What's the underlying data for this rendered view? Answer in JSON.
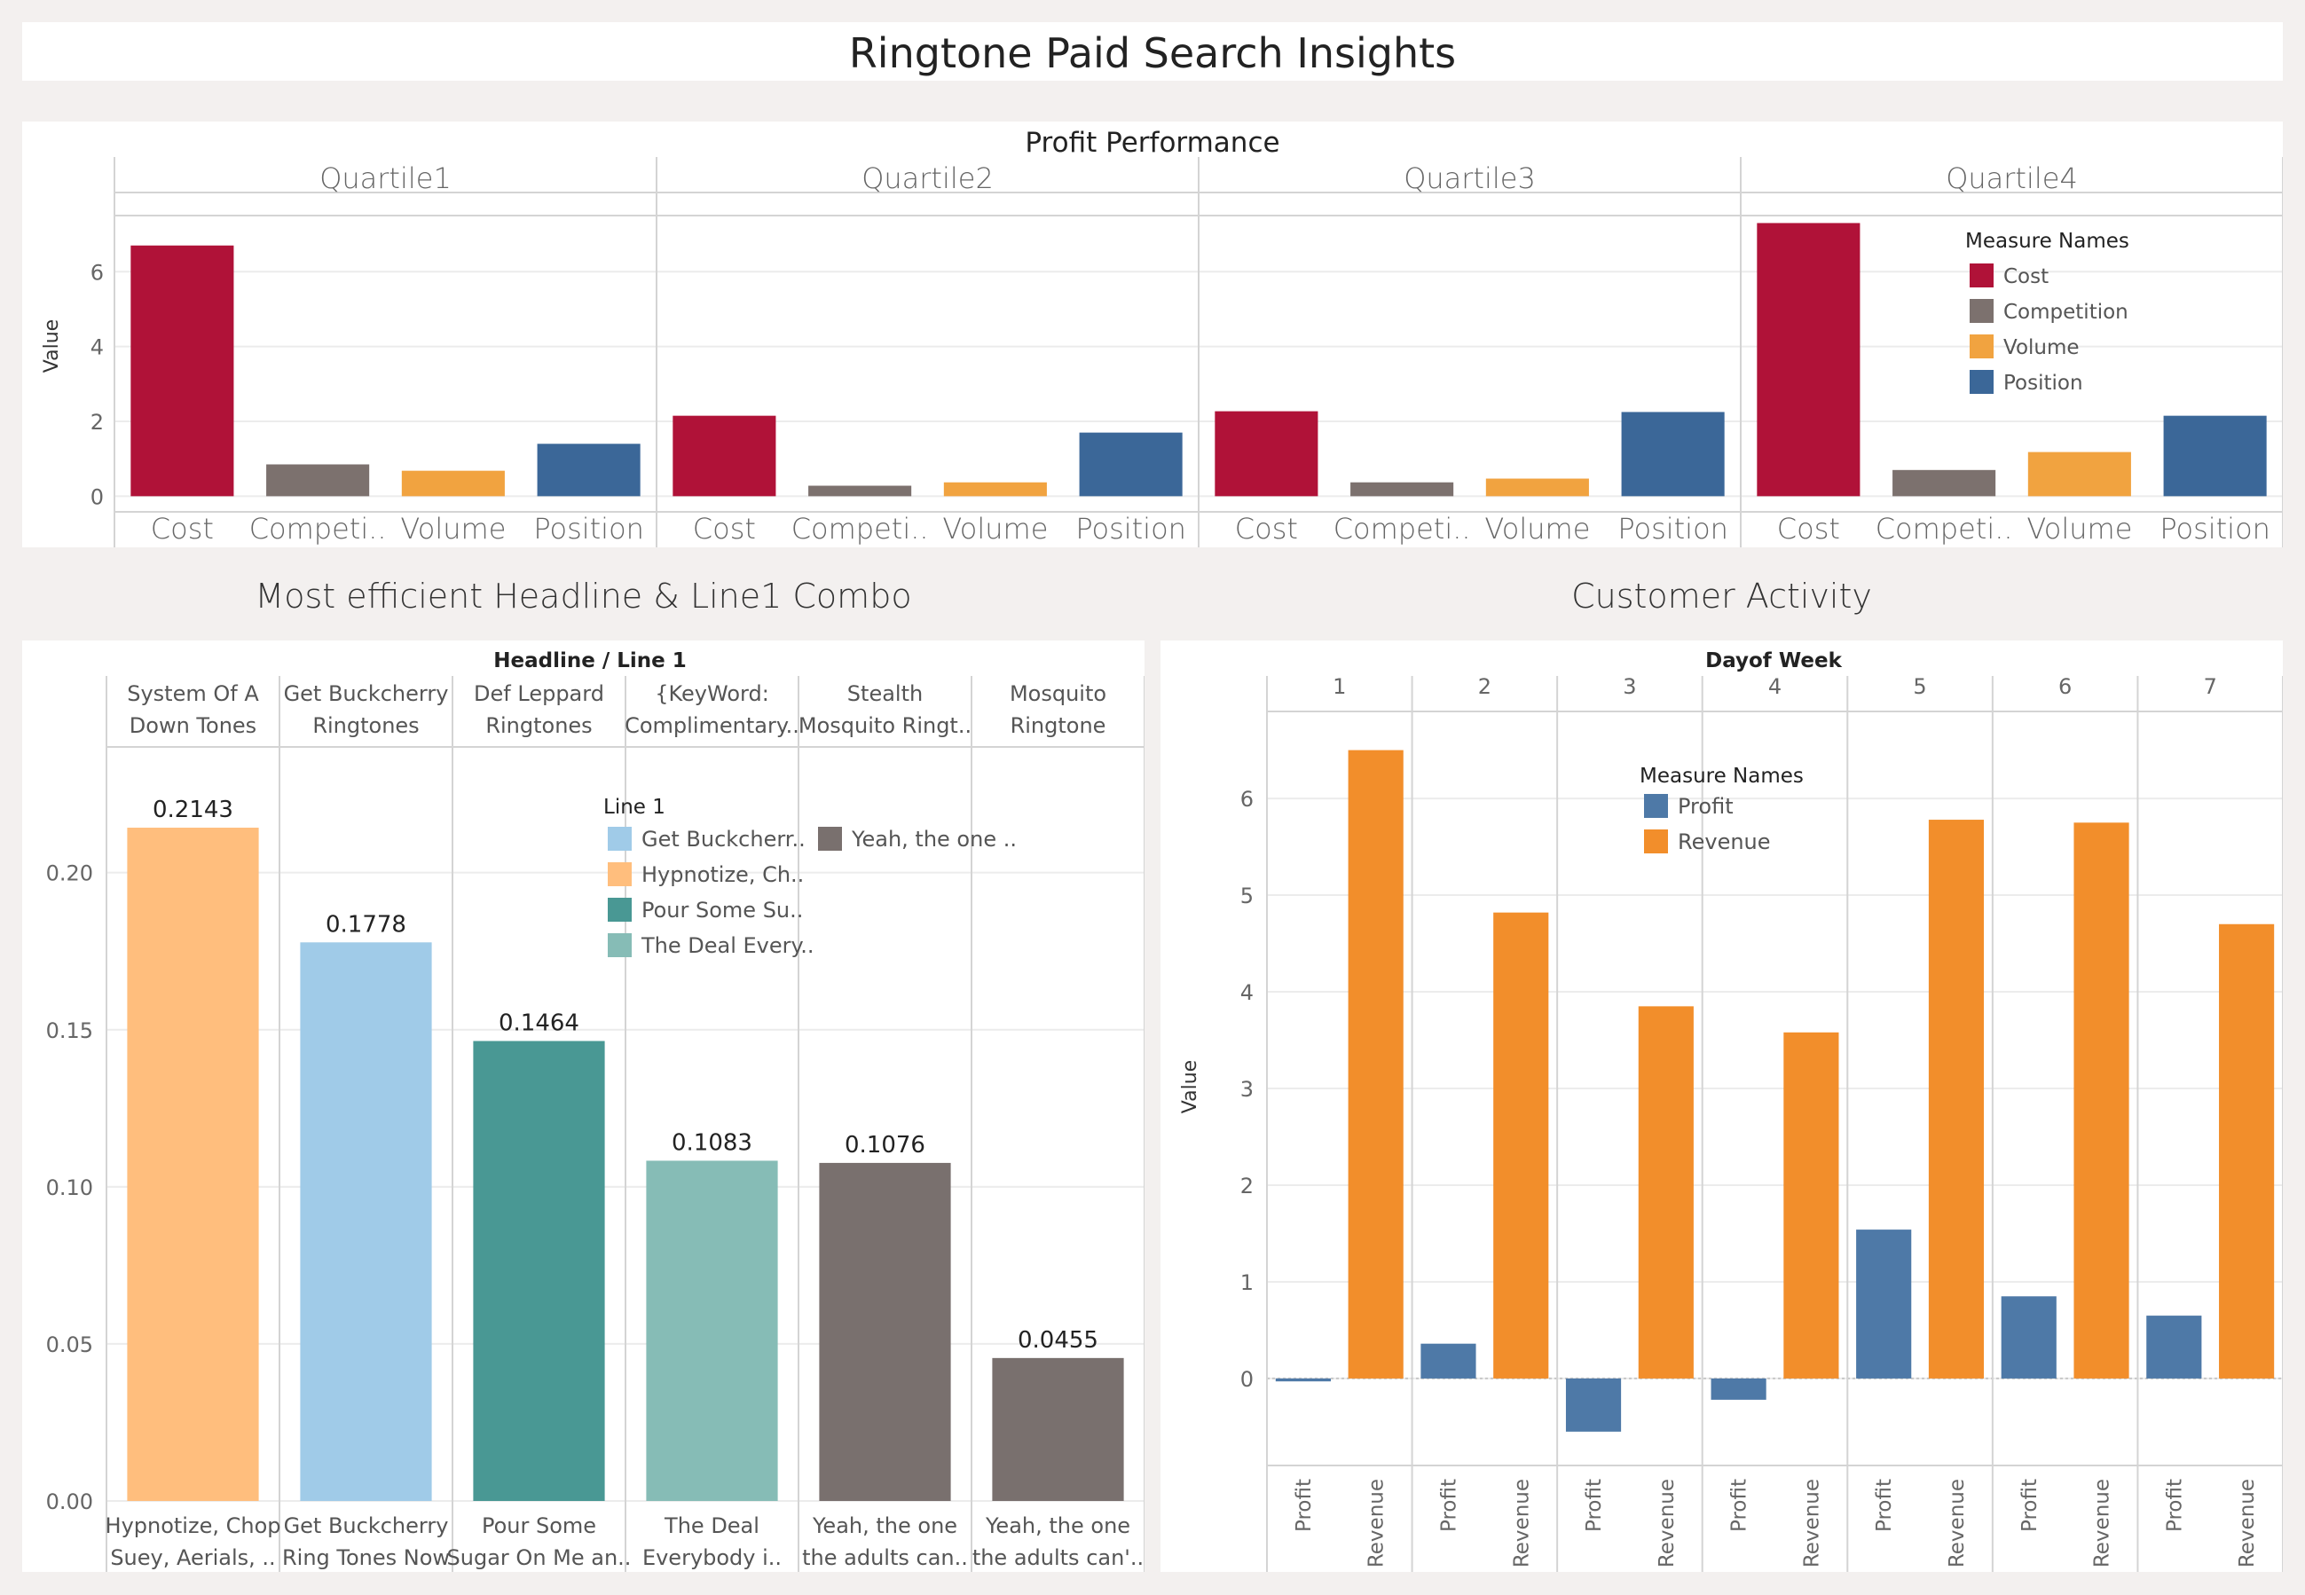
{
  "dashboard_title": "Ringtone Paid Search Insights",
  "colors": {
    "cost": "#b01238",
    "competition": "#7c716e",
    "volume": "#f1a340",
    "position": "#3b6798",
    "profit": "#4e79a7",
    "revenue": "#f28e2b",
    "hypnotize": "#ffbe7d",
    "get_buckcherry": "#a0cbe8",
    "pour_some": "#499894",
    "the_deal": "#86bcb6",
    "yeah_the_one": "#79706e"
  },
  "profit_panel": {
    "title": "Profit Performance",
    "legend_title": "Measure Names"
  },
  "headline_section_title": "Most efficient Headline & Line1 Combo",
  "headline_panel": {
    "header": "Headline  /  Line 1",
    "legend_title": "Line 1"
  },
  "customer_section_title": "Customer Activity",
  "customer_panel": {
    "header": "Dayof Week",
    "legend_title": "Measure Names"
  },
  "chart_data": [
    {
      "id": "profit_performance",
      "type": "bar",
      "title": "Profit Performance",
      "ylabel": "Value",
      "ylim": [
        -0.3,
        7.5
      ],
      "yticks": [
        0,
        2,
        4,
        6
      ],
      "facets": [
        "Quartile1",
        "Quartile2",
        "Quartile3",
        "Quartile4"
      ],
      "categories": [
        "Cost",
        "Competition",
        "Volume",
        "Position"
      ],
      "category_labels": [
        "Cost",
        "Competi..",
        "Volume",
        "Position"
      ],
      "series": [
        {
          "name": "Cost",
          "values": [
            6.7,
            2.15,
            2.27,
            7.3
          ]
        },
        {
          "name": "Competition",
          "values": [
            0.85,
            0.28,
            0.37,
            0.7
          ]
        },
        {
          "name": "Volume",
          "values": [
            0.68,
            0.37,
            0.47,
            1.18
          ]
        },
        {
          "name": "Position",
          "values": [
            1.4,
            1.7,
            2.25,
            2.15
          ]
        }
      ],
      "legend": {
        "title": "Measure Names",
        "items": [
          "Cost",
          "Competition",
          "Volume",
          "Position"
        ],
        "position": "top-right"
      },
      "grid": true
    },
    {
      "id": "headline_line1",
      "type": "bar",
      "title": "Most efficient Headline & Line1 Combo",
      "header": "Headline  /  Line 1",
      "ylim": [
        0,
        0.24
      ],
      "yticks": [
        0.0,
        0.05,
        0.1,
        0.15,
        0.2
      ],
      "ytick_labels": [
        "0.00",
        "0.05",
        "0.10",
        "0.15",
        "0.20"
      ],
      "headlines": [
        [
          "System Of A",
          "Down Tones"
        ],
        [
          "Get Buckcherry",
          "Ringtones"
        ],
        [
          "Def Leppard",
          "Ringtones"
        ],
        [
          "{KeyWord:",
          "Complimentary.."
        ],
        [
          "Stealth",
          "Mosquito Ringt.."
        ],
        [
          "Mosquito",
          "Ringtone"
        ]
      ],
      "line1": [
        [
          "Hypnotize, Chop",
          "Suey, Aerials, .."
        ],
        [
          "Get Buckcherry",
          "Ring Tones Now"
        ],
        [
          "Pour Some",
          "Sugar On Me an.."
        ],
        [
          "The Deal",
          "Everybody i.."
        ],
        [
          "Yeah, the one",
          "the adults can.."
        ],
        [
          "Yeah, the one",
          "the adults can'.."
        ]
      ],
      "values": [
        0.2143,
        0.1778,
        0.1464,
        0.1083,
        0.1076,
        0.0455
      ],
      "value_labels": [
        "0.2143",
        "0.1778",
        "0.1464",
        "0.1083",
        "0.1076",
        "0.0455"
      ],
      "bar_color_keys": [
        "hypnotize",
        "get_buckcherry",
        "pour_some",
        "the_deal",
        "yeah_the_one",
        "yeah_the_one"
      ],
      "legend": {
        "title": "Line 1",
        "items": [
          {
            "label": "Get Buckcherr..",
            "color_key": "get_buckcherry"
          },
          {
            "label": "Hypnotize, Ch..",
            "color_key": "hypnotize"
          },
          {
            "label": "Pour Some Su..",
            "color_key": "pour_some"
          },
          {
            "label": "The Deal Every..",
            "color_key": "the_deal"
          },
          {
            "label": "Yeah, the one ..",
            "color_key": "yeah_the_one"
          }
        ],
        "position": "top-right"
      },
      "grid": true
    },
    {
      "id": "customer_activity",
      "type": "bar",
      "title": "Customer Activity",
      "header": "Dayof Week",
      "ylabel": "Value",
      "ylim": [
        -0.9,
        6.9
      ],
      "yticks": [
        0,
        1,
        2,
        3,
        4,
        5,
        6
      ],
      "days": [
        "1",
        "2",
        "3",
        "4",
        "5",
        "6",
        "7"
      ],
      "categories": [
        "Profit",
        "Revenue"
      ],
      "series": [
        {
          "name": "Profit",
          "values": [
            -0.03,
            0.36,
            -0.55,
            -0.22,
            1.54,
            0.85,
            0.65
          ]
        },
        {
          "name": "Revenue",
          "values": [
            6.5,
            4.82,
            3.85,
            3.58,
            5.78,
            5.75,
            4.7
          ]
        }
      ],
      "legend": {
        "title": "Measure Names",
        "items": [
          "Profit",
          "Revenue"
        ],
        "position": "top-center"
      },
      "grid": true
    }
  ]
}
